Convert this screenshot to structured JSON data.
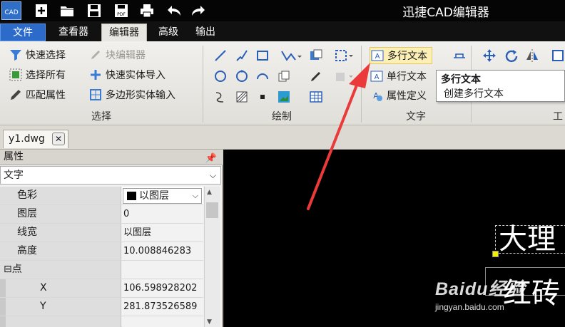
{
  "titlebar": {
    "app_icon_text": "CAD",
    "title": "迅捷CAD编辑器",
    "quick_access": [
      "new-icon",
      "open-folder-icon",
      "save-icon",
      "save-pdf-icon",
      "print-icon",
      "undo-icon",
      "redo-icon"
    ],
    "pdf_badge": "PDF"
  },
  "menu": {
    "tabs": [
      "文件",
      "查看器",
      "编辑器",
      "高级",
      "输出"
    ],
    "active": "编辑器"
  },
  "ribbon": {
    "select_group": {
      "label": "选择",
      "quick_select": "快速选择",
      "block_editor": "块编辑器",
      "select_all": "选择所有",
      "quick_entity_import": "快速实体导入",
      "match_properties": "匹配属性",
      "polygon_entity_input": "多边形实体输入"
    },
    "draw_group": {
      "label": "绘制"
    },
    "text_group": {
      "label": "文字",
      "mtext": "多行文本",
      "single_text": "单行文本",
      "attr_define": "属性定义"
    },
    "tools_group": {
      "label_partial": "工"
    }
  },
  "tooltip": {
    "title": "多行文本",
    "description": "创建多行文本"
  },
  "document": {
    "tab_name": "y1.dwg",
    "close_glyph": "✕"
  },
  "properties_panel": {
    "title": "属性",
    "pin_glyph": "📌",
    "entity_type": "文字",
    "rows": [
      {
        "name": "色彩",
        "value": "以图层"
      },
      {
        "name": "图层",
        "value": "0"
      },
      {
        "name": "线宽",
        "value": "以图层"
      },
      {
        "name": "高度",
        "value": "10.008846283"
      },
      {
        "name": "点",
        "value": ""
      },
      {
        "name": "X",
        "value": "106.598928202"
      },
      {
        "name": "Y",
        "value": "281.873526589"
      }
    ],
    "collapse_glyph": "⊟"
  },
  "canvas": {
    "text_line1": "大理",
    "text_line2": "红砖"
  },
  "watermark": {
    "brand": "Baidu经验",
    "url": "jingyan.baidu.com"
  },
  "colors": {
    "titlebar_bg": "#050505",
    "file_tab": "#2c6bc9",
    "arrow": "#ea3a3a",
    "canvas_bg": "#000000",
    "grip": "#f0f000"
  }
}
